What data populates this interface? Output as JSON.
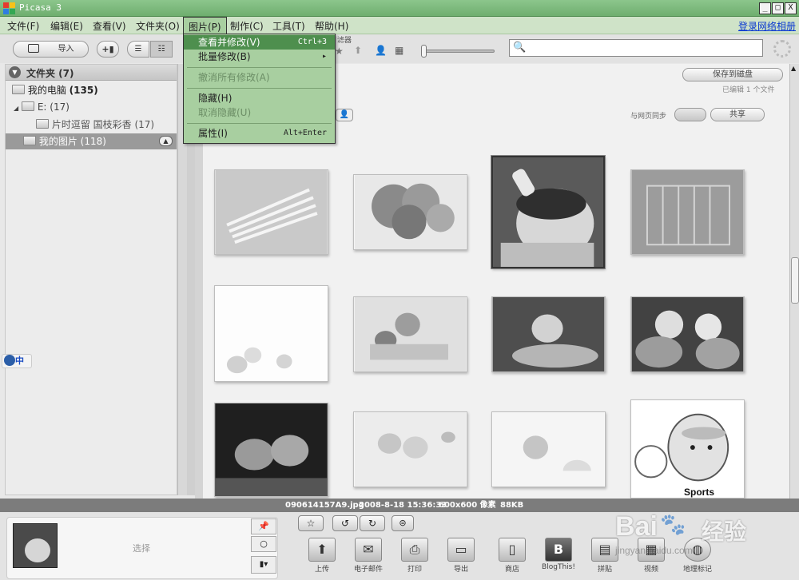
{
  "window": {
    "title": "Picasa 3",
    "min": "_",
    "max": "□",
    "close": "X"
  },
  "menubar": {
    "items": [
      "文件(F)",
      "编辑(E)",
      "查看(V)",
      "文件夹(O)",
      "图片(P)",
      "制作(C)",
      "工具(T)",
      "帮助(H)"
    ],
    "login": "登录网络相册"
  },
  "toolbar": {
    "import": "导入",
    "filter_label": "滤器"
  },
  "sidebar": {
    "header": "文件夹 (7)",
    "items": [
      {
        "label": "我的电脑",
        "count": "(135)"
      },
      {
        "label": "E:",
        "count": "(17)"
      },
      {
        "label": "片时逗留 国枝彩香",
        "count": "(17)"
      },
      {
        "label": "我的图片",
        "count": "(118)"
      }
    ]
  },
  "main": {
    "save_to_disk": "保存到磁盘",
    "edited_info": "已编辑 1 个文件",
    "sync_label": "与网页同步",
    "share": "共享"
  },
  "ime": {
    "label": "中"
  },
  "dropdown": {
    "items": [
      {
        "label": "查看并修改(V)",
        "shortcut": "Ctrl+3"
      },
      {
        "label": "批量修改(B)",
        "submenu": "▸"
      },
      {
        "label": "撤消所有修改(A)"
      },
      {
        "label": "隐藏(H)"
      },
      {
        "label": "取消隐藏(U)"
      },
      {
        "label": "属性(I)",
        "shortcut": "Alt+Enter"
      }
    ]
  },
  "status": {
    "filename": "090614157A9.jpg",
    "date": "2008-8-18 15:36:33",
    "size": "600x600 像素",
    "filesize": "88KB"
  },
  "tray": {
    "select": "选择",
    "tools": [
      "上传",
      "电子邮件",
      "打印",
      "导出",
      "商店",
      "BlogThis!",
      "拼贴",
      "视频",
      "地理标记"
    ]
  },
  "thumbnails": [
    {
      "caption": ""
    },
    {
      "caption": ""
    },
    {
      "caption": ""
    },
    {
      "caption": ""
    },
    {
      "caption": ""
    },
    {
      "caption": ""
    },
    {
      "caption": ""
    },
    {
      "caption": ""
    },
    {
      "caption": ""
    },
    {
      "caption": ""
    },
    {
      "caption": ""
    },
    {
      "caption": "Sports"
    }
  ],
  "watermark": {
    "brand": "Bai",
    "suffix": "经验",
    "url": "jingyan.baidu.com"
  }
}
